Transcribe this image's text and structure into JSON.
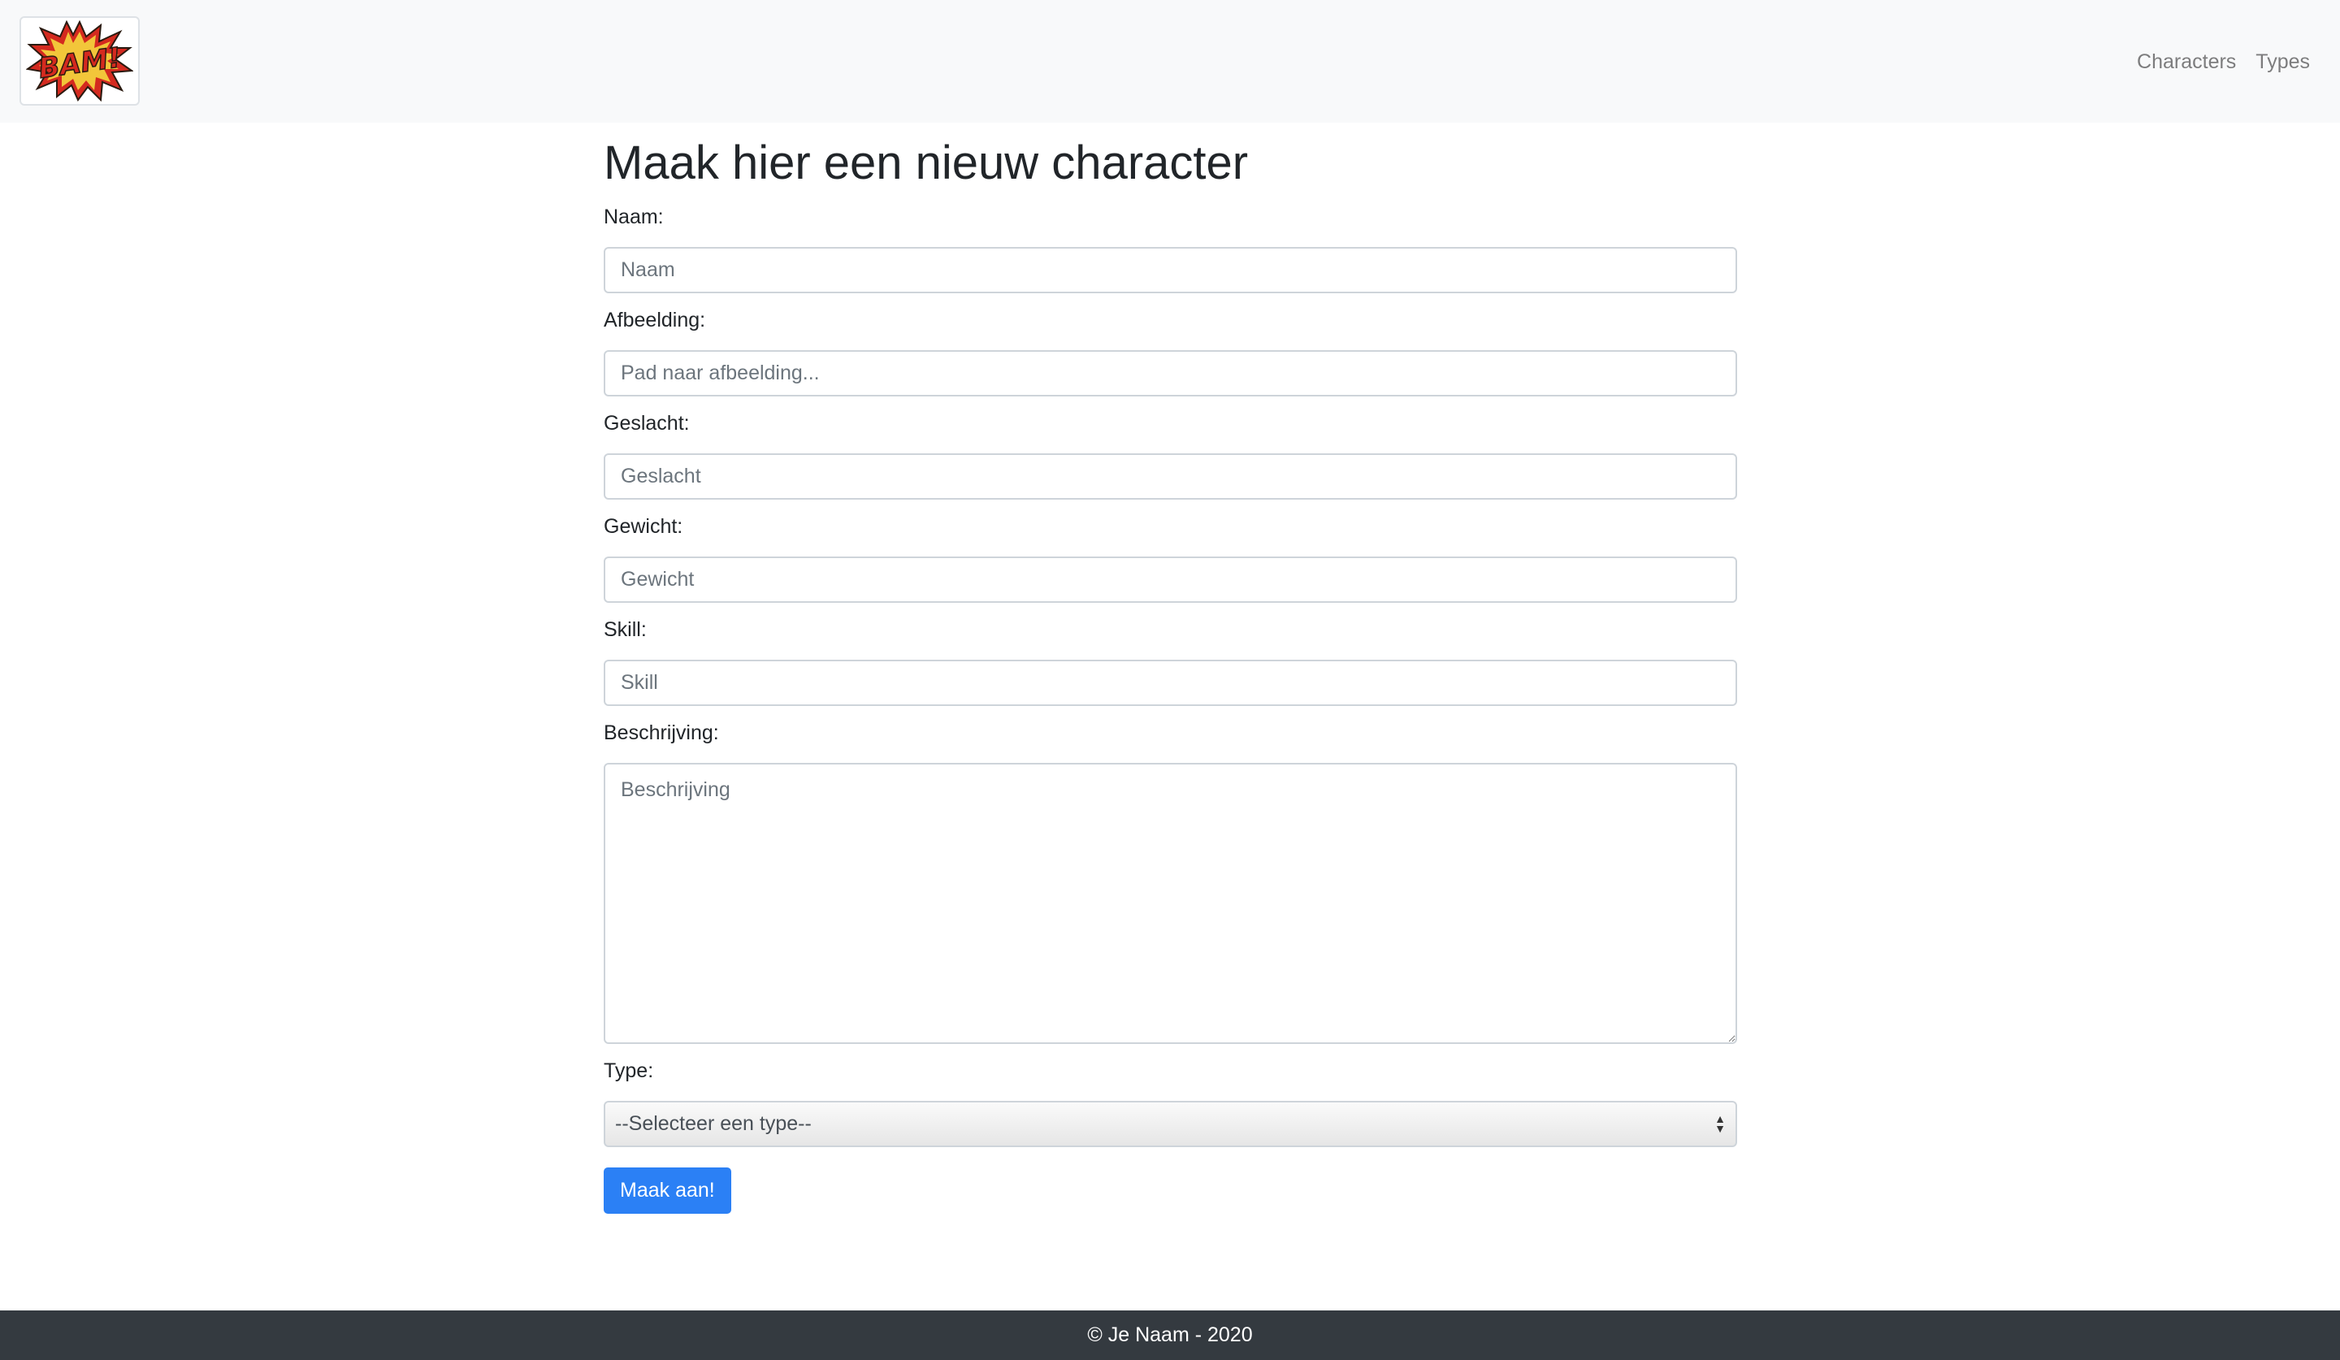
{
  "navbar": {
    "logo_text": "BAM!",
    "links": [
      {
        "label": "Characters"
      },
      {
        "label": "Types"
      }
    ]
  },
  "page": {
    "title": "Maak hier een nieuw character"
  },
  "form": {
    "naam": {
      "label": "Naam:",
      "placeholder": "Naam",
      "value": ""
    },
    "afbeelding": {
      "label": "Afbeelding:",
      "placeholder": "Pad naar afbeelding...",
      "value": ""
    },
    "geslacht": {
      "label": "Geslacht:",
      "placeholder": "Geslacht",
      "value": ""
    },
    "gewicht": {
      "label": "Gewicht:",
      "placeholder": "Gewicht",
      "value": ""
    },
    "skill": {
      "label": "Skill:",
      "placeholder": "Skill",
      "value": ""
    },
    "beschrijving": {
      "label": "Beschrijving:",
      "placeholder": "Beschrijving",
      "value": ""
    },
    "type": {
      "label": "Type:",
      "selected": "--Selecteer een type--"
    },
    "submit_label": "Maak aan!"
  },
  "footer": {
    "text": "© Je Naam - 2020"
  },
  "colors": {
    "navbar_bg": "#f8f9fa",
    "primary": "#2b80f5",
    "footer_bg": "#343a40"
  },
  "icons": {
    "logo": "bam-comic-burst-logo",
    "select_arrows": "sort-arrows-icon"
  }
}
